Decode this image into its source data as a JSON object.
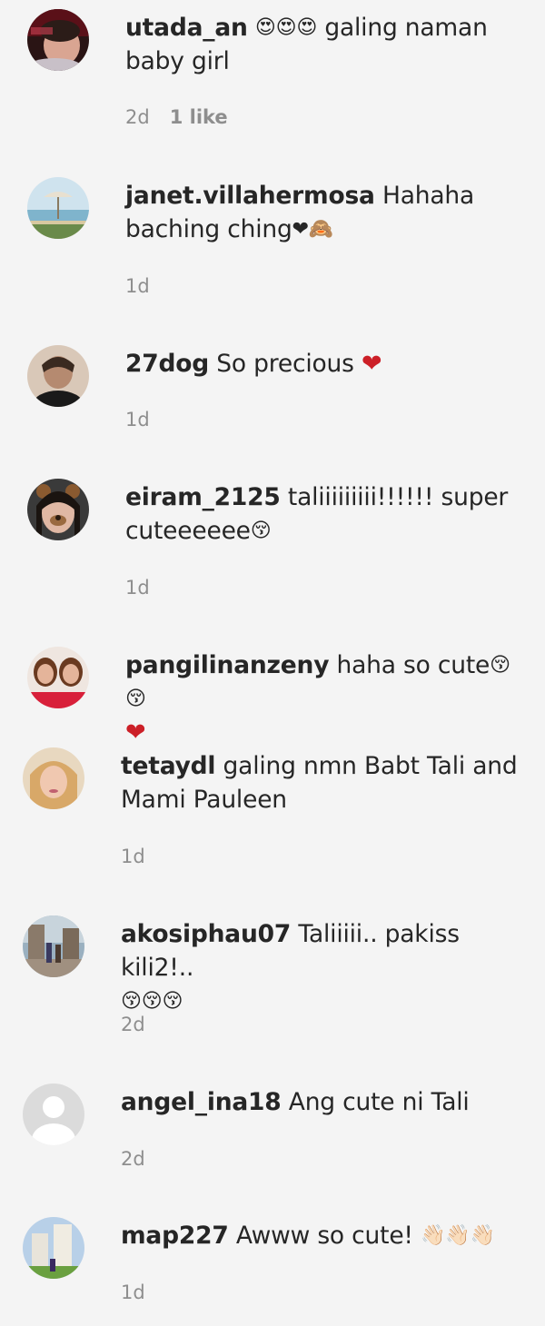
{
  "comments": [
    {
      "username": "utada_an",
      "text": "galing naman baby girl",
      "prefix_emoji": "😍😍😍",
      "suffix_emoji": "",
      "time": "2d",
      "likes": "1 like"
    },
    {
      "username": "janet.villahermosa",
      "text": "Hahaha baching ching",
      "prefix_emoji": "",
      "suffix_emoji": "❤🙈",
      "time": "1d",
      "likes": ""
    },
    {
      "username": "27dog",
      "text": "So precious",
      "prefix_emoji": "",
      "suffix_emoji": "❤",
      "time": "1d",
      "likes": ""
    },
    {
      "username": "eiram_2125",
      "text": "taliiiiiiiii!!!!!! super cuteeeeee",
      "prefix_emoji": "",
      "suffix_emoji": "😚",
      "time": "1d",
      "likes": ""
    },
    {
      "username": "pangilinanzeny",
      "text": "haha so cute",
      "prefix_emoji": "",
      "suffix_emoji": "😚😚",
      "second_line_emoji": "❤",
      "time": "",
      "likes": ""
    },
    {
      "username": "tetaydl",
      "text": "galing nmn Babt Tali and Mami Pauleen",
      "prefix_emoji": "",
      "suffix_emoji": "",
      "time": "1d",
      "likes": ""
    },
    {
      "username": "akosiphau07",
      "text": "Taliiiii.. pakiss kili2!..",
      "prefix_emoji": "",
      "suffix_emoji": "",
      "second_line_emoji": "😚😚😚",
      "time": "2d",
      "likes": ""
    },
    {
      "username": "angel_ina18",
      "text": "Ang cute ni Tali",
      "prefix_emoji": "",
      "suffix_emoji": "",
      "time": "2d",
      "likes": ""
    },
    {
      "username": "map227",
      "text": "Awww so cute!",
      "prefix_emoji": "",
      "suffix_emoji": "👋🏻👋🏻👋🏻",
      "time": "1d",
      "likes": ""
    }
  ]
}
